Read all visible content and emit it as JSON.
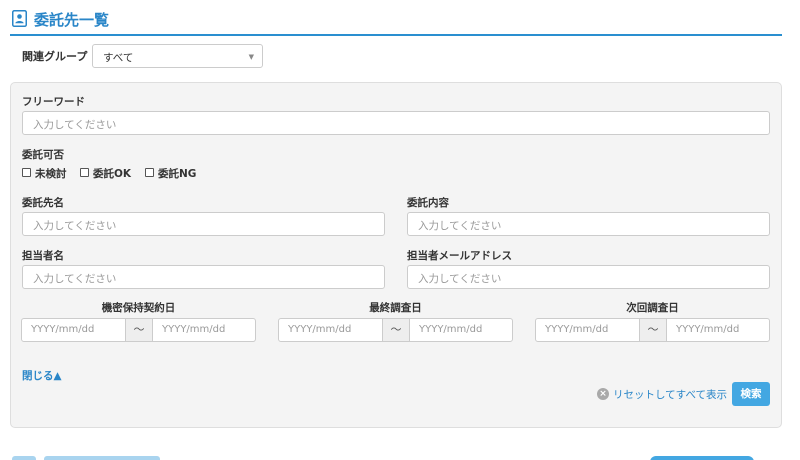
{
  "header": {
    "title": "委託先一覧",
    "icon": "contact-card-icon",
    "accent_color": "#2a86c8"
  },
  "group_filter": {
    "label": "関連グループ",
    "selected": "すべて"
  },
  "search_panel": {
    "free_word": {
      "label": "フリーワード",
      "placeholder": "入力してください"
    },
    "consignment_status": {
      "label": "委託可否",
      "options": [
        {
          "label": "未検討",
          "checked": false
        },
        {
          "label": "委託OK",
          "checked": false
        },
        {
          "label": "委託NG",
          "checked": false
        }
      ]
    },
    "contractor_name": {
      "label": "委託先名",
      "placeholder": "入力してください"
    },
    "consignment_content": {
      "label": "委託内容",
      "placeholder": "入力してください"
    },
    "person_name": {
      "label": "担当者名",
      "placeholder": "入力してください"
    },
    "person_email": {
      "label": "担当者メールアドレス",
      "placeholder": "入力してください"
    },
    "date_ranges": [
      {
        "label": "機密保持契約日",
        "from_placeholder": "YYYY/mm/dd",
        "separator": "〜",
        "to_placeholder": "YYYY/mm/dd"
      },
      {
        "label": "最終調査日",
        "from_placeholder": "YYYY/mm/dd",
        "separator": "〜",
        "to_placeholder": "YYYY/mm/dd"
      },
      {
        "label": "次回調査日",
        "from_placeholder": "YYYY/mm/dd",
        "separator": "〜",
        "to_placeholder": "YYYY/mm/dd"
      }
    ],
    "close_link": "閉じる▲",
    "reset_link": "リセットしてすべて表示",
    "search_button": "検索"
  }
}
